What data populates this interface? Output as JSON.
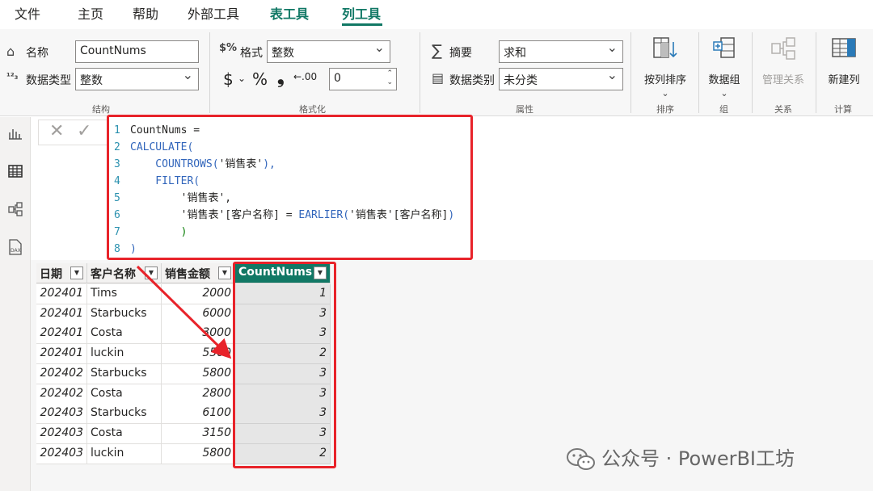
{
  "tabs": [
    {
      "label": "文件"
    },
    {
      "label": "主页"
    },
    {
      "label": "帮助"
    },
    {
      "label": "外部工具"
    },
    {
      "label": "表工具"
    },
    {
      "label": "列工具"
    }
  ],
  "ribbon": {
    "structure": {
      "group_label": "结构",
      "name_label": "名称",
      "name_value": "CountNums",
      "datatype_label": "数据类型",
      "datatype_value": "整数"
    },
    "formatting": {
      "group_label": "格式化",
      "format_label": "格式",
      "format_value": "整数",
      "currency_symbol": "$",
      "percent_symbol": "%",
      "comma_symbol": "❟",
      "decimals_value": "0"
    },
    "properties": {
      "group_label": "属性",
      "summarize_label": "摘要",
      "summarize_value": "求和",
      "category_label": "数据类别",
      "category_value": "未分类"
    },
    "sort": {
      "group_label": "排序",
      "button_label": "按列排序"
    },
    "groups": {
      "group_label": "组",
      "button_label": "数据组"
    },
    "relationships": {
      "group_label": "关系",
      "button_label": "管理关系"
    },
    "calculations": {
      "group_label": "计算",
      "button_label": "新建列"
    }
  },
  "formula": {
    "lines": [
      {
        "num": "1",
        "parts": [
          {
            "t": "CountNums =",
            "c": "c-plain"
          }
        ]
      },
      {
        "num": "2",
        "parts": [
          {
            "t": "CALCULATE(",
            "c": "c-fn"
          }
        ]
      },
      {
        "num": "3",
        "parts": [
          {
            "t": "    COUNTROWS(",
            "c": "c-fn"
          },
          {
            "t": "'销售表'",
            "c": "c-plain"
          },
          {
            "t": "),",
            "c": "c-fn"
          }
        ]
      },
      {
        "num": "4",
        "parts": [
          {
            "t": "    FILTER(",
            "c": "c-fn"
          }
        ]
      },
      {
        "num": "5",
        "parts": [
          {
            "t": "        '销售表',",
            "c": "c-plain"
          }
        ]
      },
      {
        "num": "6",
        "parts": [
          {
            "t": "        '销售表'[客户名称] = ",
            "c": "c-plain"
          },
          {
            "t": "EARLIER(",
            "c": "c-fn"
          },
          {
            "t": "'销售表'[客户名称]",
            "c": "c-plain"
          },
          {
            "t": ")",
            "c": "c-fn"
          }
        ]
      },
      {
        "num": "7",
        "parts": [
          {
            "t": "        )",
            "c": "c-paren"
          }
        ]
      },
      {
        "num": "8",
        "parts": [
          {
            "t": ")",
            "c": "c-fn"
          }
        ]
      }
    ]
  },
  "table": {
    "columns": [
      "日期",
      "客户名称",
      "销售金额",
      "CountNums"
    ],
    "rows": [
      [
        "202401",
        "Tims",
        "2000",
        "1"
      ],
      [
        "202401",
        "Starbucks",
        "6000",
        "3"
      ],
      [
        "202401",
        "Costa",
        "3000",
        "3"
      ],
      [
        "202401",
        "luckin",
        "5500",
        "2"
      ],
      [
        "202402",
        "Starbucks",
        "5800",
        "3"
      ],
      [
        "202402",
        "Costa",
        "2800",
        "3"
      ],
      [
        "202403",
        "Starbucks",
        "6100",
        "3"
      ],
      [
        "202403",
        "Costa",
        "3150",
        "3"
      ],
      [
        "202403",
        "luckin",
        "5800",
        "2"
      ]
    ]
  },
  "watermark": {
    "text": "公众号 · PowerBI工坊"
  },
  "colors": {
    "accent": "#117865",
    "highlight": "#e8232a"
  }
}
